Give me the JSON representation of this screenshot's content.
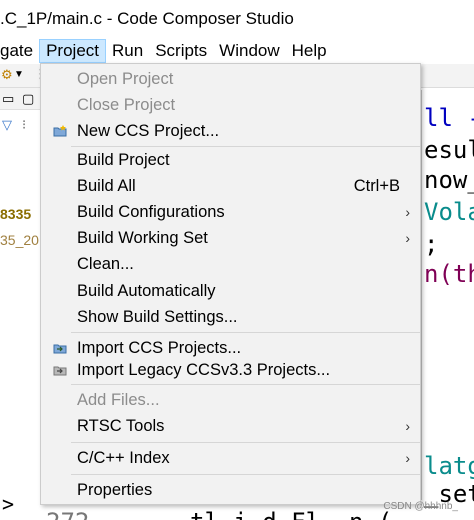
{
  "window": {
    "title": ".C_1P/main.c - Code Composer Studio"
  },
  "menubar": {
    "items": [
      "gate",
      "Project",
      "Run",
      "Scripts",
      "Window",
      "Help"
    ],
    "active": "Project"
  },
  "sidebar": {
    "tree_items": [
      "8335",
      "35_20"
    ]
  },
  "editor": {
    "code_fragments": [
      "ll -",
      "esul",
      "now_",
      "Vola",
      ";",
      "n(th",
      "latg",
      "_set",
      "272",
      "tl.i.d Fl..n (",
      ">"
    ]
  },
  "project_menu": {
    "groups": [
      [
        {
          "label": "Open Project",
          "enabled": false
        },
        {
          "label": "Close Project",
          "enabled": false
        },
        {
          "label": "New CCS Project...",
          "enabled": true,
          "icon": "new-ccs-project-icon"
        }
      ],
      [
        {
          "label": "Build Project",
          "enabled": true
        },
        {
          "label": "Build All",
          "enabled": true,
          "accelerator": "Ctrl+B"
        },
        {
          "label": "Build Configurations",
          "enabled": true,
          "submenu": true
        },
        {
          "label": "Build Working Set",
          "enabled": true,
          "submenu": true
        },
        {
          "label": "Clean...",
          "enabled": true
        },
        {
          "label": "Build Automatically",
          "enabled": true
        },
        {
          "label": "Show Build Settings...",
          "enabled": true
        }
      ],
      [
        {
          "label": "Import CCS Projects...",
          "enabled": true,
          "icon": "import-projects-icon"
        },
        {
          "label": "Import Legacy CCSv3.3 Projects...",
          "enabled": true,
          "icon": "import-legacy-icon"
        }
      ],
      [
        {
          "label": "Add Files...",
          "enabled": false
        },
        {
          "label": "RTSC Tools",
          "enabled": true,
          "submenu": true
        }
      ],
      [
        {
          "label": "C/C++ Index",
          "enabled": true,
          "submenu": true
        }
      ],
      [
        {
          "label": "Properties",
          "enabled": true
        }
      ]
    ],
    "submenu_arrow": "›"
  },
  "watermark": {
    "text": "CSDN @hhhnb_"
  },
  "colors": {
    "menu_bg": "#f2f2f2",
    "active_menu_bg": "#cce8ff",
    "disabled_text": "#8c8c8c",
    "keyword": "#7f0055",
    "teal": "#0a8c8c",
    "blue": "#0000c0"
  }
}
